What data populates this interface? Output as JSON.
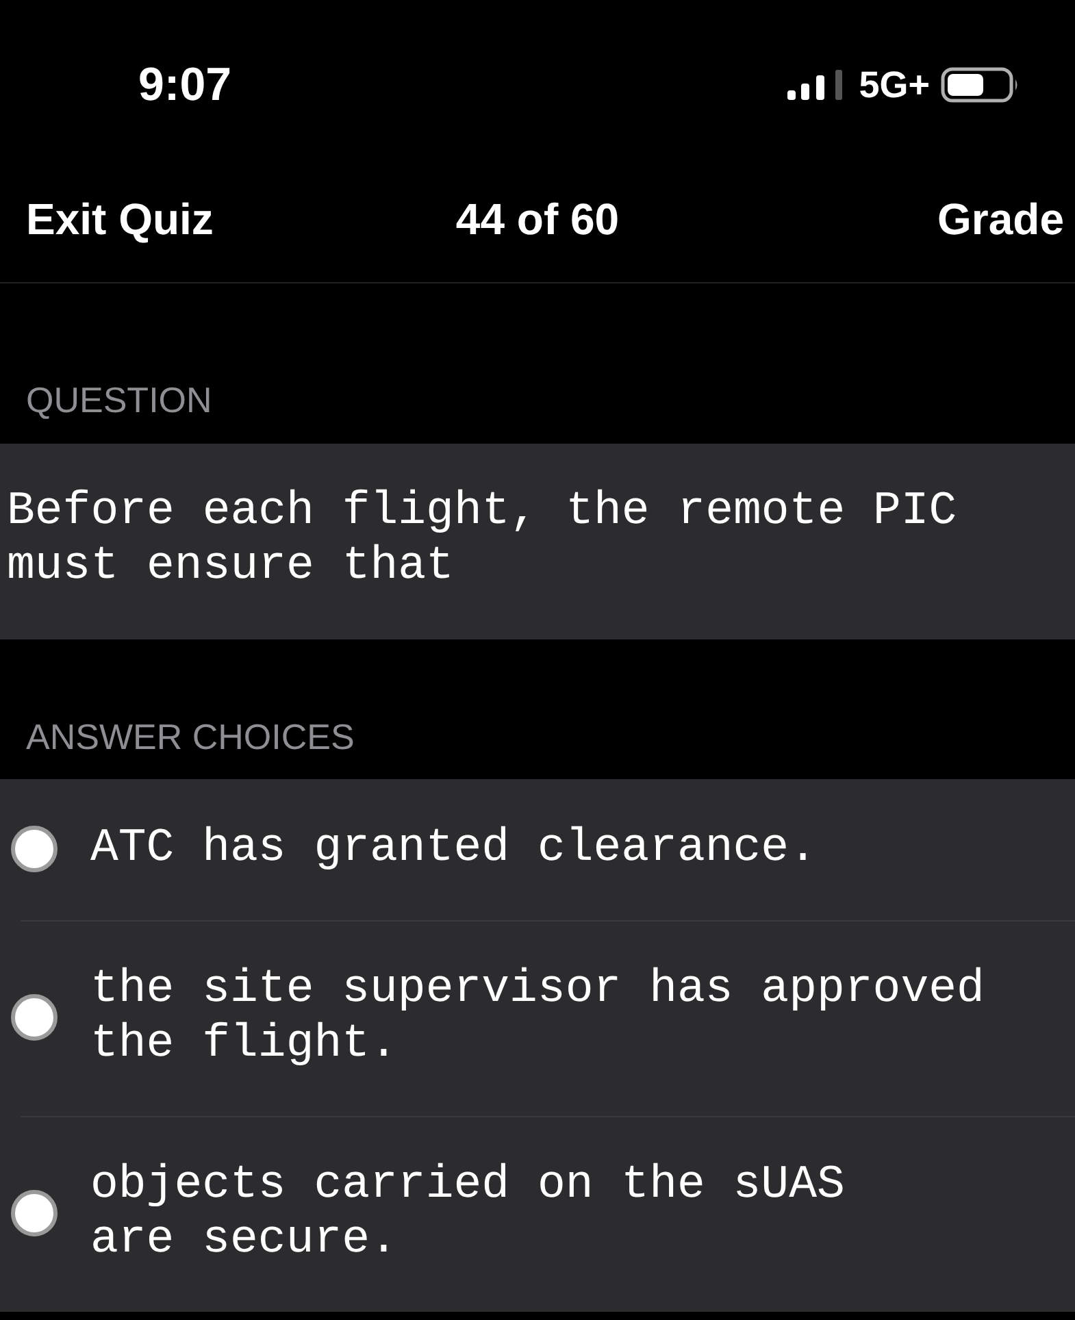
{
  "status_bar": {
    "time": "9:07",
    "network": "5G+"
  },
  "nav": {
    "left_button": "Exit Quiz",
    "title": "44 of 60",
    "right_button": "Grade"
  },
  "question": {
    "label": "QUESTION",
    "text": "Before each flight, the remote PIC must ensure that"
  },
  "answers": {
    "label": "ANSWER CHOICES",
    "choices": [
      {
        "text": "ATC has granted clearance.",
        "selected": false
      },
      {
        "text": "the site supervisor has approved the flight.",
        "selected": false
      },
      {
        "text": "objects carried on the sUAS\nare secure.",
        "selected": false
      }
    ]
  }
}
